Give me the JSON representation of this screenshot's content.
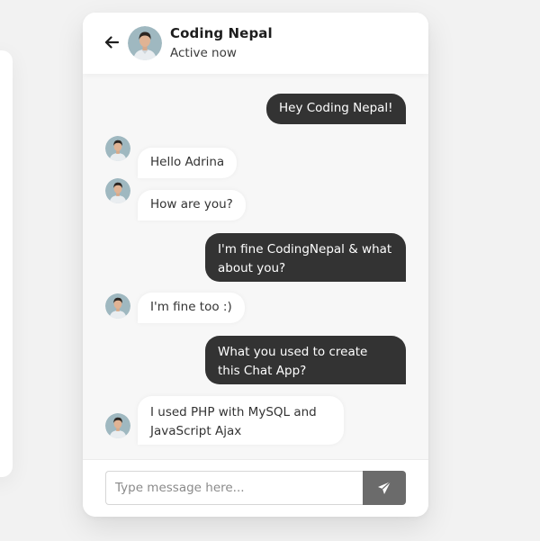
{
  "header": {
    "contact_name": "Coding Nepal",
    "status": "Active now",
    "back_icon": "arrow-left-icon",
    "avatar": "contact-avatar"
  },
  "messages": [
    {
      "direction": "out",
      "text": "Hey Coding Nepal!"
    },
    {
      "direction": "in",
      "text": "Hello Adrina"
    },
    {
      "direction": "in",
      "text": "How are you?"
    },
    {
      "direction": "out",
      "text": "I'm fine CodingNepal & what about you?"
    },
    {
      "direction": "in",
      "text": "I'm fine too :)"
    },
    {
      "direction": "out",
      "text": "What you used to create this Chat App?"
    },
    {
      "direction": "in",
      "text": "I used PHP with MySQL and JavaScript Ajax"
    }
  ],
  "composer": {
    "placeholder": "Type message here...",
    "value": "",
    "send_icon": "paper-plane-icon"
  },
  "colors": {
    "outgoing_bubble": "#333333",
    "incoming_bubble": "#ffffff",
    "send_button": "#6b6b6b",
    "chat_background": "#f7f7f7"
  }
}
